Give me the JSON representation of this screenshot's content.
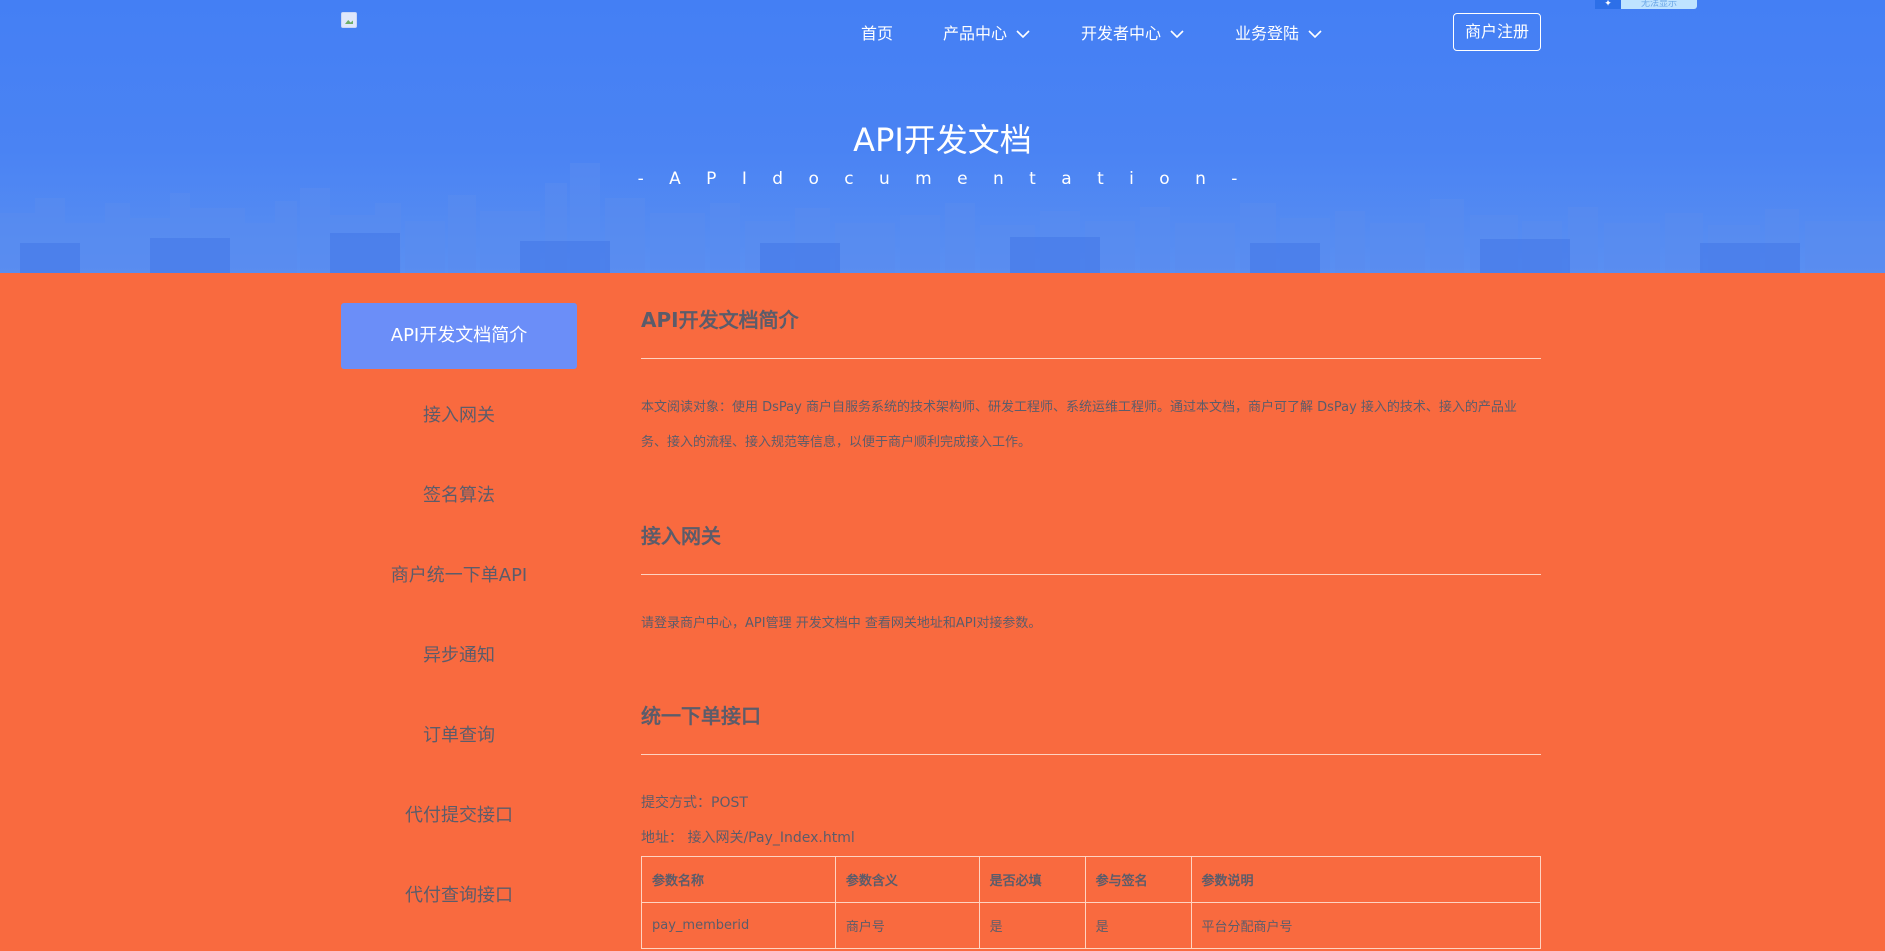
{
  "header": {
    "nav": [
      {
        "label": "首页",
        "has_dropdown": false
      },
      {
        "label": "产品中心",
        "has_dropdown": true
      },
      {
        "label": "开发者中心",
        "has_dropdown": true
      },
      {
        "label": "业务登陆",
        "has_dropdown": true
      }
    ],
    "register_label": "商户注册",
    "badge_text": "无法显示"
  },
  "hero": {
    "title": "API开发文档",
    "subtitle": "- A P I   d o c u m e n t a t i o n   -"
  },
  "sidebar": {
    "items": [
      {
        "label": "API开发文档简介",
        "active": true
      },
      {
        "label": "接入网关",
        "active": false
      },
      {
        "label": "签名算法",
        "active": false
      },
      {
        "label": "商户统一下单API",
        "active": false
      },
      {
        "label": "异步通知",
        "active": false
      },
      {
        "label": "订单查询",
        "active": false
      },
      {
        "label": "代付提交接口",
        "active": false
      },
      {
        "label": "代付查询接口",
        "active": false
      }
    ]
  },
  "content": {
    "intro": {
      "title": "API开发文档简介",
      "text": "本文阅读对象：使用 DsPay 商户自服务系统的技术架构师、研发工程师、系统运维工程师。通过本文档，商户可了解 DsPay 接入的技术、接入的产品业务、接入的流程、接入规范等信息，以便于商户顺利完成接入工作。"
    },
    "gateway": {
      "title": "接入网关",
      "text": "请登录商户中心，API管理 开发文档中 查看网关地址和API对接参数。"
    },
    "order": {
      "title": "统一下单接口",
      "method": "提交方式：POST",
      "address": "地址：  接入网关/Pay_Index.html",
      "table": {
        "headers": [
          "参数名称",
          "参数含义",
          "是否必填",
          "参与签名",
          "参数说明"
        ],
        "rows": [
          [
            "pay_memberid",
            "商户号",
            "是",
            "是",
            "平台分配商户号"
          ]
        ]
      }
    }
  },
  "colors": {
    "hero_blue": "#447ff4",
    "page_orange": "#f96a3f",
    "active_item": "#6b8ef8",
    "text": "#5c5c6a"
  }
}
